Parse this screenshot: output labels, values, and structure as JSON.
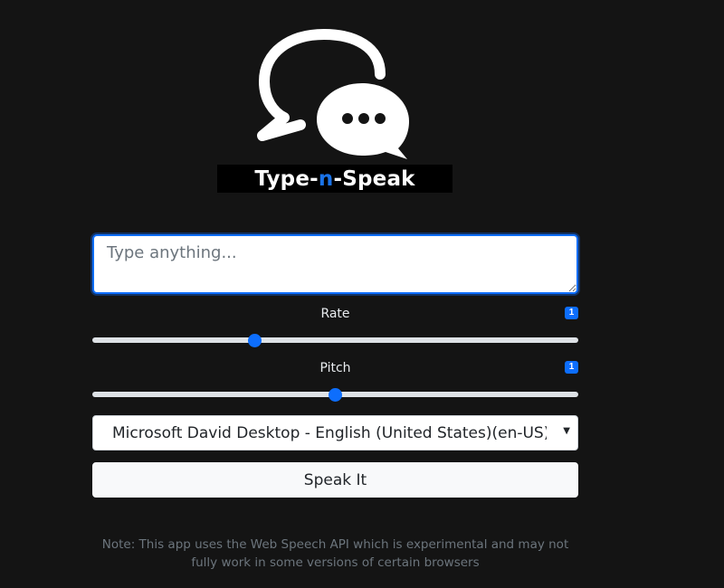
{
  "app": {
    "logo_icon": "chat-bubbles-icon",
    "logo_text_pre": "Type-",
    "logo_text_accent": "n",
    "logo_text_post": "-Speak",
    "accent_color": "#1a73e8"
  },
  "text_input": {
    "placeholder": "Type anything...",
    "value": ""
  },
  "rate": {
    "label": "Rate",
    "badge": "1",
    "value": 1,
    "min": 0.5,
    "max": 2
  },
  "pitch": {
    "label": "Pitch",
    "badge": "1",
    "value": 1,
    "min": 0,
    "max": 2
  },
  "voice_select": {
    "selected": "Microsoft David Desktop - English (United States)(en-US)"
  },
  "speak_button": {
    "label": "Speak It"
  },
  "note": {
    "text": "Note: This app uses the Web Speech API which is experimental and may not fully work in some versions of certain browsers"
  }
}
